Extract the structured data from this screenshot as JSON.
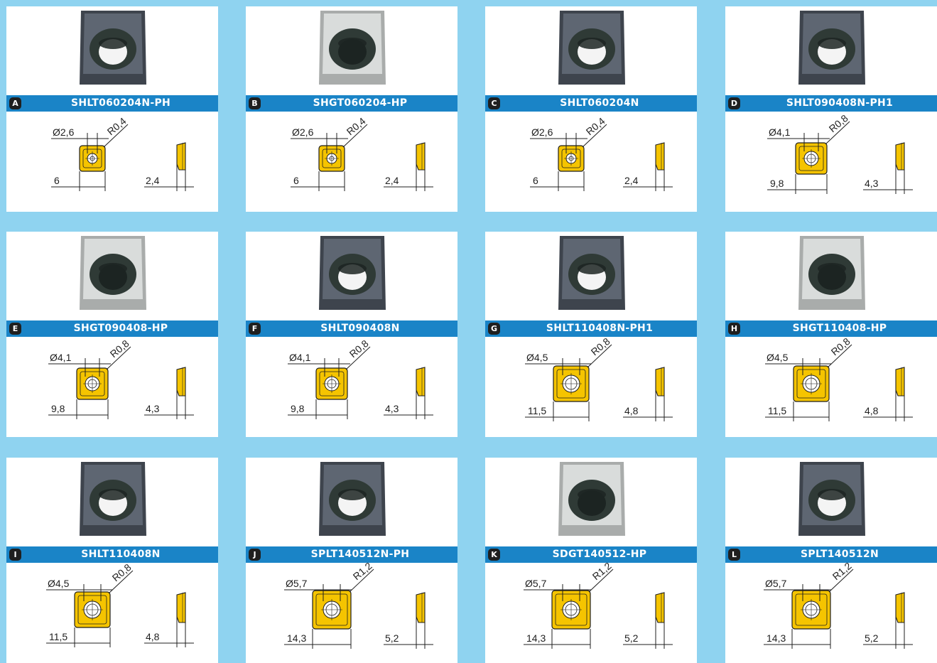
{
  "inserts": [
    {
      "letter": "A",
      "code": "SHLT060204N-PH",
      "hole": "Ø2,6",
      "radius": "R0,4",
      "size": "6",
      "thickness": "2,4",
      "coating": "dark"
    },
    {
      "letter": "B",
      "code": "SHGT060204-HP",
      "hole": "Ø2,6",
      "radius": "R0,4",
      "size": "6",
      "thickness": "2,4",
      "coating": "light"
    },
    {
      "letter": "C",
      "code": "SHLT060204N",
      "hole": "Ø2,6",
      "radius": "R0,4",
      "size": "6",
      "thickness": "2,4",
      "coating": "dark"
    },
    {
      "letter": "D",
      "code": "SHLT090408N-PH1",
      "hole": "Ø4,1",
      "radius": "R0,8",
      "size": "9,8",
      "thickness": "4,3",
      "coating": "dark"
    },
    {
      "letter": "E",
      "code": "SHGT090408-HP",
      "hole": "Ø4,1",
      "radius": "R0,8",
      "size": "9,8",
      "thickness": "4,3",
      "coating": "light"
    },
    {
      "letter": "F",
      "code": "SHLT090408N",
      "hole": "Ø4,1",
      "radius": "R0,8",
      "size": "9,8",
      "thickness": "4,3",
      "coating": "dark"
    },
    {
      "letter": "G",
      "code": "SHLT110408N-PH1",
      "hole": "Ø4,5",
      "radius": "R0,8",
      "size": "11,5",
      "thickness": "4,8",
      "coating": "dark"
    },
    {
      "letter": "H",
      "code": "SHGT110408-HP",
      "hole": "Ø4,5",
      "radius": "R0,8",
      "size": "11,5",
      "thickness": "4,8",
      "coating": "light"
    },
    {
      "letter": "I",
      "code": "SHLT110408N",
      "hole": "Ø4,5",
      "radius": "R0,8",
      "size": "11,5",
      "thickness": "4,8",
      "coating": "dark"
    },
    {
      "letter": "J",
      "code": "SPLT140512N-PH",
      "hole": "Ø5,7",
      "radius": "R1,2",
      "size": "14,3",
      "thickness": "5,2",
      "coating": "dark"
    },
    {
      "letter": "K",
      "code": "SDGT140512-HP",
      "hole": "Ø5,7",
      "radius": "R1,2",
      "size": "14,3",
      "thickness": "5,2",
      "coating": "light"
    },
    {
      "letter": "L",
      "code": "SPLT140512N",
      "hole": "Ø5,7",
      "radius": "R1,2",
      "size": "14,3",
      "thickness": "5,2",
      "coating": "dark"
    }
  ],
  "colors": {
    "background": "#8fd3f0",
    "title_bar": "#1a84c7",
    "insert_drawing": "#f5c400",
    "dark_coating": "#5e6672",
    "light_coating": "#d9dcdb"
  }
}
